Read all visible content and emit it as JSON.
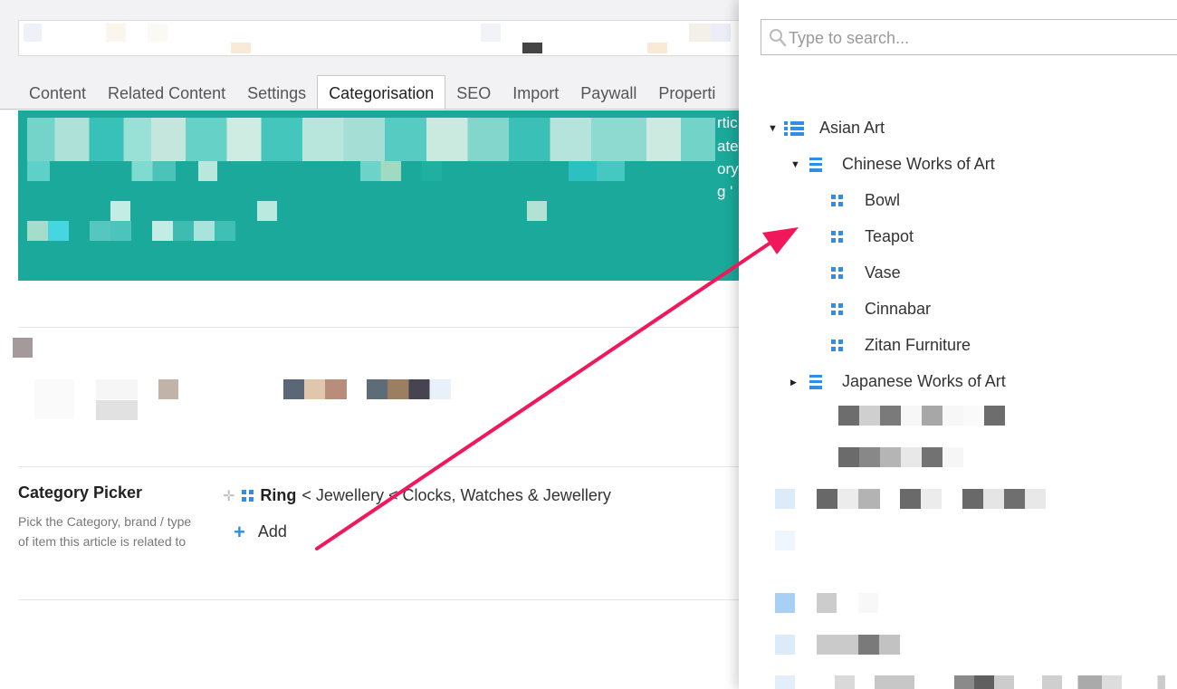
{
  "tabs": [
    {
      "label": "Content",
      "active": false
    },
    {
      "label": "Related Content",
      "active": false
    },
    {
      "label": "Settings",
      "active": false
    },
    {
      "label": "Categorisation",
      "active": true
    },
    {
      "label": "SEO",
      "active": false
    },
    {
      "label": "Import",
      "active": false
    },
    {
      "label": "Paywall",
      "active": false
    },
    {
      "label": "Properti",
      "active": false
    }
  ],
  "teal_block": {
    "color": "#1aa99a",
    "right_text": [
      "rtic",
      "ate",
      "ory",
      "g '"
    ]
  },
  "category_picker": {
    "title": "Category Picker",
    "description": "Pick the Category, brand / type of item this article is related to",
    "selected": {
      "name": "Ring",
      "path": "< Jewellery < Clocks, Watches & Jewellery",
      "icon": "grid-icon"
    },
    "add_label": "Add"
  },
  "panel": {
    "search": {
      "placeholder": "Type to search...",
      "value": ""
    },
    "tree": {
      "root": {
        "label": "Asian Art",
        "expanded": true,
        "icon": "list-icon"
      },
      "children": [
        {
          "label": "Chinese Works of Art",
          "expanded": true,
          "icon": "lines-icon"
        },
        {
          "label": "Japanese Works of Art",
          "expanded": false,
          "icon": "lines-icon"
        }
      ],
      "leaves": [
        "Bowl",
        "Teapot",
        "Vase",
        "Cinnabar",
        "Zitan Furniture"
      ]
    }
  },
  "colors": {
    "accent": "#2f8fe8",
    "arrow": "#f0185b",
    "teal": "#1aa99a"
  }
}
